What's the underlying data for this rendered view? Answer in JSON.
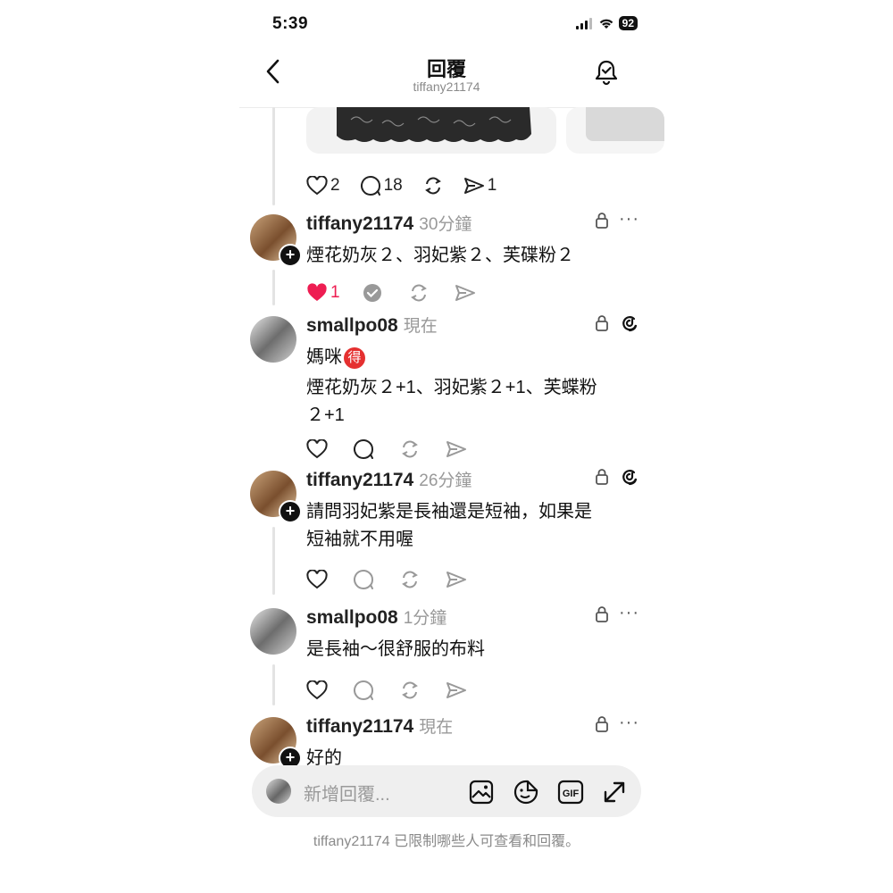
{
  "status_bar": {
    "time": "5:39",
    "battery": "92"
  },
  "header": {
    "title": "回覆",
    "subtitle": "tiffany21174"
  },
  "post_actions": {
    "likes": "2",
    "replies": "18",
    "shares": "1"
  },
  "comments": [
    {
      "username": "tiffany21174",
      "time": "30分鐘",
      "lines": [
        "煙花奶灰２、羽妃紫２、芙碟粉２"
      ],
      "like_count": "1",
      "liked": true
    },
    {
      "username": "smallpo08",
      "time": "現在",
      "lines": [
        "媽咪",
        "煙花奶灰２+1、羽妃紫２+1、芙蝶粉",
        "２+1"
      ],
      "badge": "得"
    },
    {
      "username": "tiffany21174",
      "time": "26分鐘",
      "lines": [
        "請問羽妃紫是長袖還是短袖，如果是",
        "短袖就不用喔"
      ]
    },
    {
      "username": "smallpo08",
      "time": "1分鐘",
      "lines": [
        "是長袖～很舒服的布料"
      ]
    },
    {
      "username": "tiffany21174",
      "time": "現在",
      "lines": [
        "好的"
      ]
    }
  ],
  "reply_bar": {
    "placeholder": "新增回覆..."
  },
  "footer": {
    "notice": "tiffany21174 已限制哪些人可查看和回覆。"
  },
  "colors": {
    "like_red": "#ee1d52",
    "muted": "#8a8a8a"
  }
}
